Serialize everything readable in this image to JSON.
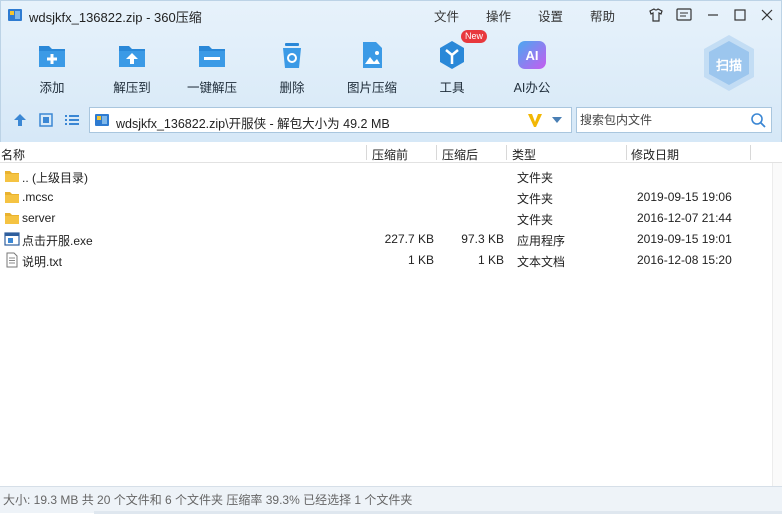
{
  "window": {
    "title": "wdsjkfx_136822.zip - 360压缩",
    "menus": [
      "文件",
      "操作",
      "设置",
      "帮助"
    ]
  },
  "toolbar": {
    "items": [
      {
        "label": "添加",
        "icon": "add-icon"
      },
      {
        "label": "解压到",
        "icon": "extract-to-icon"
      },
      {
        "label": "一键解压",
        "icon": "one-click-extract-icon"
      },
      {
        "label": "删除",
        "icon": "delete-icon"
      },
      {
        "label": "图片压缩",
        "icon": "image-compress-icon"
      },
      {
        "label": "工具",
        "icon": "tools-icon",
        "badge": "New"
      },
      {
        "label": "AI办公",
        "icon": "ai-office-icon",
        "icon_text": "AI"
      }
    ],
    "scan_label": "扫描"
  },
  "address": {
    "path": "wdsjkfx_136822.zip\\开服侠 - 解包大小为 49.2 MB"
  },
  "search": {
    "placeholder": "搜索包内文件"
  },
  "columns": {
    "name": "名称",
    "packed": "压缩前",
    "orig": "压缩后",
    "type": "类型",
    "date": "修改日期"
  },
  "files": [
    {
      "name": ".. (上级目录)",
      "packed": "",
      "orig": "",
      "type": "文件夹",
      "date": "",
      "icon": "folder-icon"
    },
    {
      "name": ".mcsc",
      "packed": "",
      "orig": "",
      "type": "文件夹",
      "date": "2019-09-15 19:06",
      "icon": "folder-icon"
    },
    {
      "name": "server",
      "packed": "",
      "orig": "",
      "type": "文件夹",
      "date": "2016-12-07 21:44",
      "icon": "folder-icon"
    },
    {
      "name": "点击开服.exe",
      "packed": "227.7 KB",
      "orig": "97.3 KB",
      "type": "应用程序",
      "date": "2019-09-15 19:01",
      "icon": "exe-icon"
    },
    {
      "name": "说明.txt",
      "packed": "1 KB",
      "orig": "1 KB",
      "type": "文本文档",
      "date": "2016-12-08 15:20",
      "icon": "text-file-icon"
    }
  ],
  "status": {
    "text": "大小: 19.3 MB 共 20 个文件和 6 个文件夹 压缩率 39.3% 已经选择 1 个文件夹"
  },
  "colors": {
    "accent": "#2a88d8",
    "folder": "#f5c342"
  }
}
